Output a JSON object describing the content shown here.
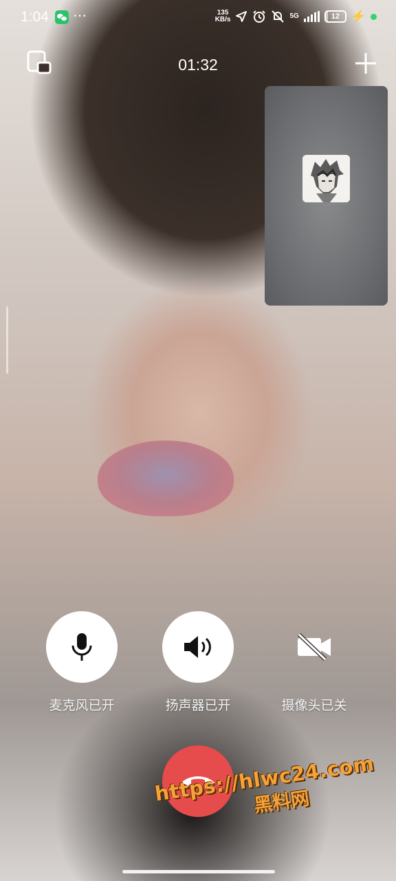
{
  "status_bar": {
    "time": "1:04",
    "more": "⋯",
    "net_speed_value": "135",
    "net_speed_unit": "KB/s",
    "network": "5G",
    "battery": "12"
  },
  "call": {
    "timer": "01:32"
  },
  "controls": {
    "microphone_label": "麦克风已开",
    "speaker_label": "扬声器已开",
    "camera_label": "摄像头已关"
  },
  "watermark": {
    "url": "https://hlwc24.com",
    "name": "黑料网"
  },
  "colors": {
    "hangup": "#e74c4c",
    "wechat_green": "#2bc26b",
    "watermark": "#f3a33a"
  }
}
